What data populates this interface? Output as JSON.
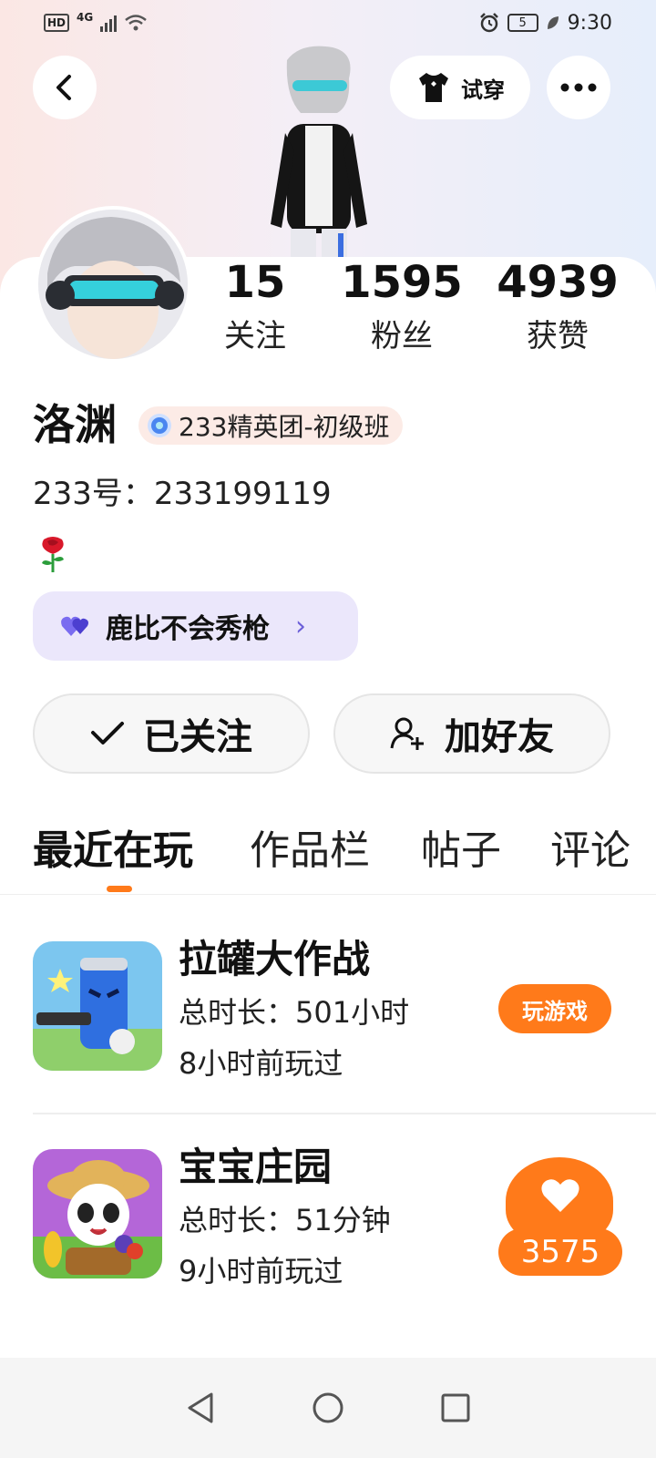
{
  "status_bar": {
    "hd": "HD",
    "network": "4G",
    "battery": "5",
    "time": "9:30"
  },
  "header": {
    "try_on_label": "试穿"
  },
  "stats": [
    {
      "value": "15",
      "label": "关注"
    },
    {
      "value": "1595",
      "label": "粉丝"
    },
    {
      "value": "4939",
      "label": "获赞"
    }
  ],
  "profile": {
    "nickname": "洛渊",
    "badge": "233精英团-初级班",
    "uid": "233号：233199119",
    "cp_label": "鹿比不会秀枪"
  },
  "actions": {
    "follow_label": "已关注",
    "add_friend_label": "加好友"
  },
  "tabs": [
    "最近在玩",
    "作品栏",
    "帖子",
    "评论"
  ],
  "games": [
    {
      "title": "拉罐大作战",
      "duration": "总时长：501小时",
      "last_played": "8小时前玩过",
      "button": "玩游戏"
    },
    {
      "title": "宝宝庄园",
      "duration": "总时长：51分钟",
      "last_played": "9小时前玩过"
    }
  ],
  "like_count": "3575",
  "colors": {
    "accent": "#ff7a1a",
    "chip_bg": "#ebe7fb",
    "badge_bg": "#fcebe6"
  }
}
